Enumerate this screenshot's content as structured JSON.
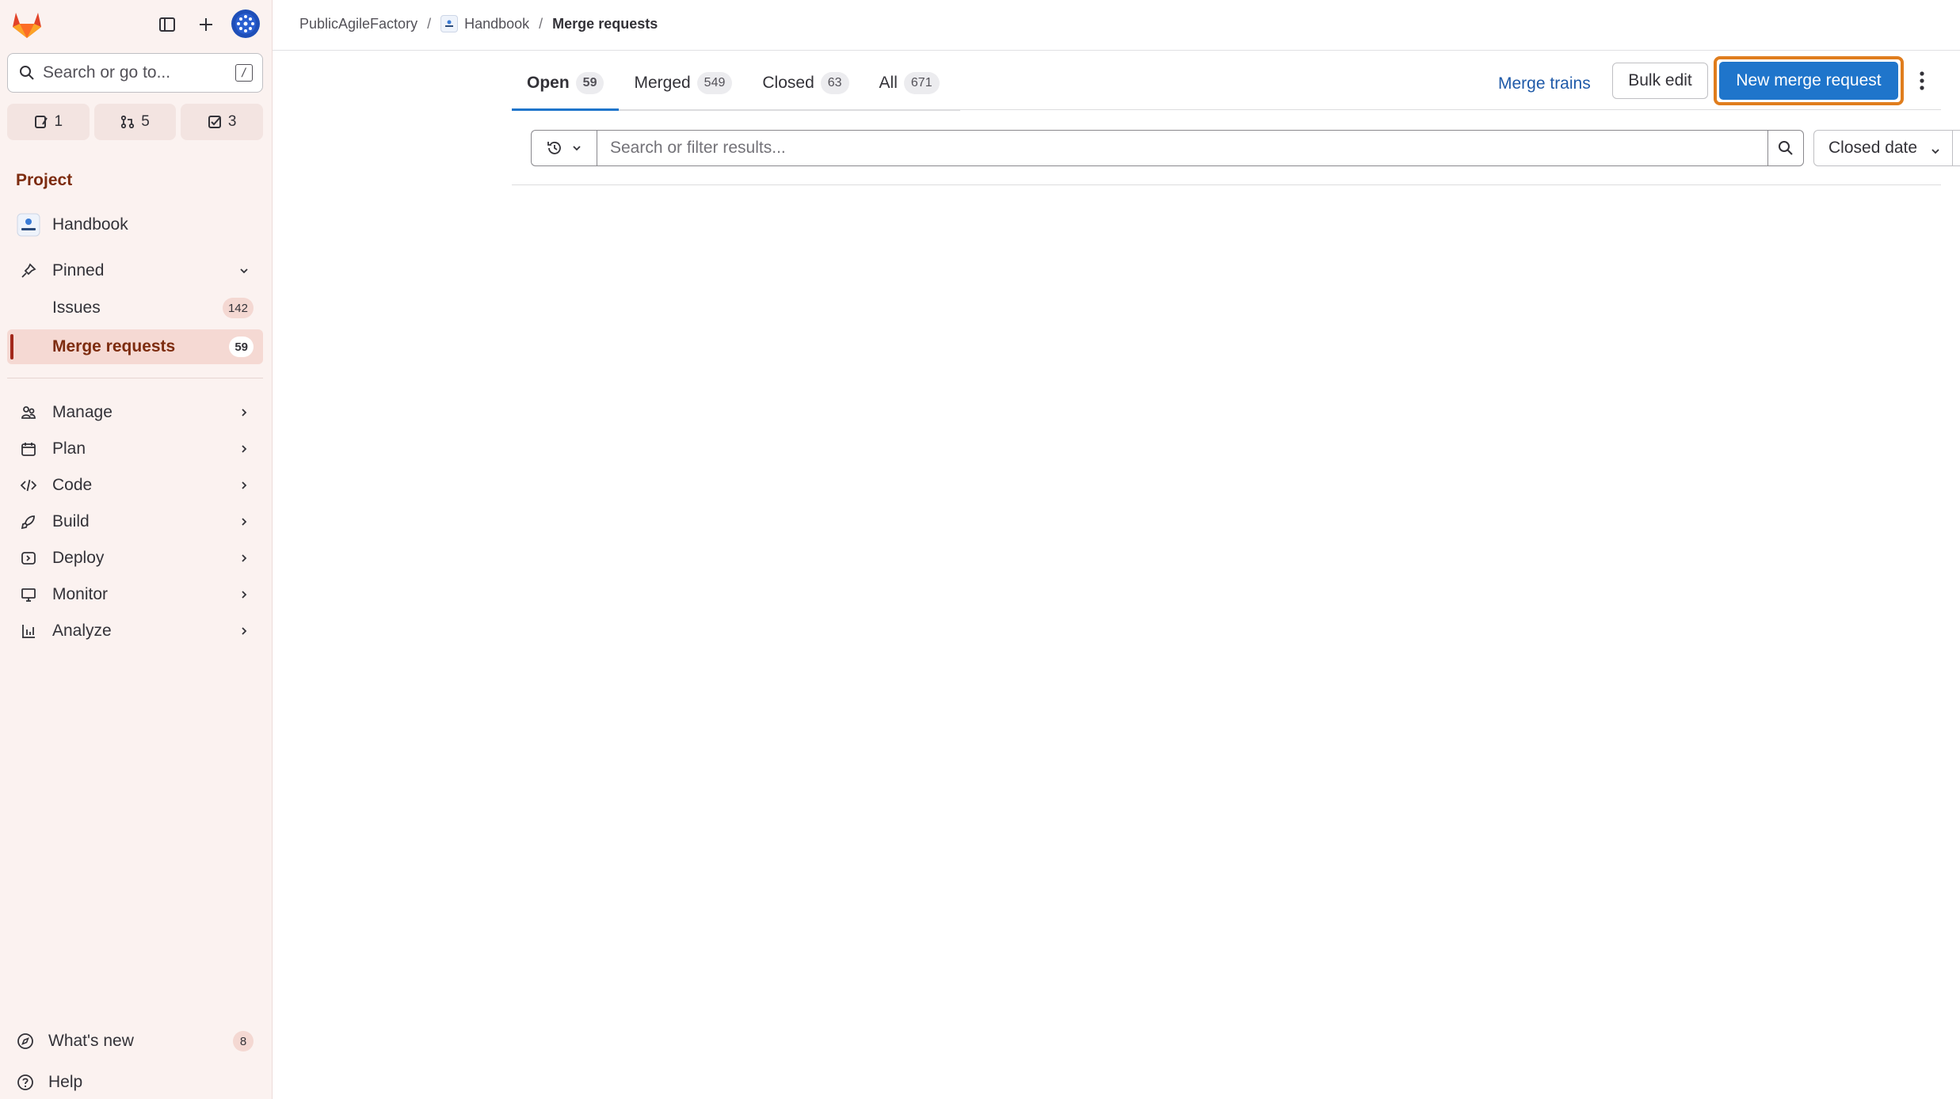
{
  "sidebar": {
    "search_placeholder": "Search or go to...",
    "search_shortcut": "/",
    "counters": [
      {
        "icon": "issue-icon",
        "value": "1"
      },
      {
        "icon": "merge-request-icon",
        "value": "5"
      },
      {
        "icon": "todo-icon",
        "value": "3"
      }
    ],
    "section_title": "Project",
    "project_name": "Handbook",
    "pinned_label": "Pinned",
    "pinned_items": [
      {
        "label": "Issues",
        "count": "142"
      },
      {
        "label": "Merge requests",
        "count": "59"
      }
    ],
    "menu": [
      {
        "label": "Manage",
        "icon": "manage-icon"
      },
      {
        "label": "Plan",
        "icon": "plan-icon"
      },
      {
        "label": "Code",
        "icon": "code-icon"
      },
      {
        "label": "Build",
        "icon": "build-icon"
      },
      {
        "label": "Deploy",
        "icon": "deploy-icon"
      },
      {
        "label": "Monitor",
        "icon": "monitor-icon"
      },
      {
        "label": "Analyze",
        "icon": "analyze-icon"
      }
    ],
    "whats_new": {
      "label": "What's new",
      "count": "8"
    },
    "help": {
      "label": "Help"
    }
  },
  "breadcrumb": {
    "group": "PublicAgileFactory",
    "project": "Handbook",
    "current": "Merge requests"
  },
  "tabs": [
    {
      "label": "Open",
      "count": "59",
      "active": true
    },
    {
      "label": "Merged",
      "count": "549"
    },
    {
      "label": "Closed",
      "count": "63"
    },
    {
      "label": "All",
      "count": "671"
    }
  ],
  "actions": {
    "merge_trains": "Merge trains",
    "bulk_edit": "Bulk edit",
    "new_merge_request": "New merge request"
  },
  "filter": {
    "placeholder": "Search or filter results...",
    "sort_label": "Closed date"
  },
  "colors": {
    "accent": "#1f75cb",
    "highlight": "#e07d1d",
    "sidebar_bg": "#fbf2f0"
  }
}
